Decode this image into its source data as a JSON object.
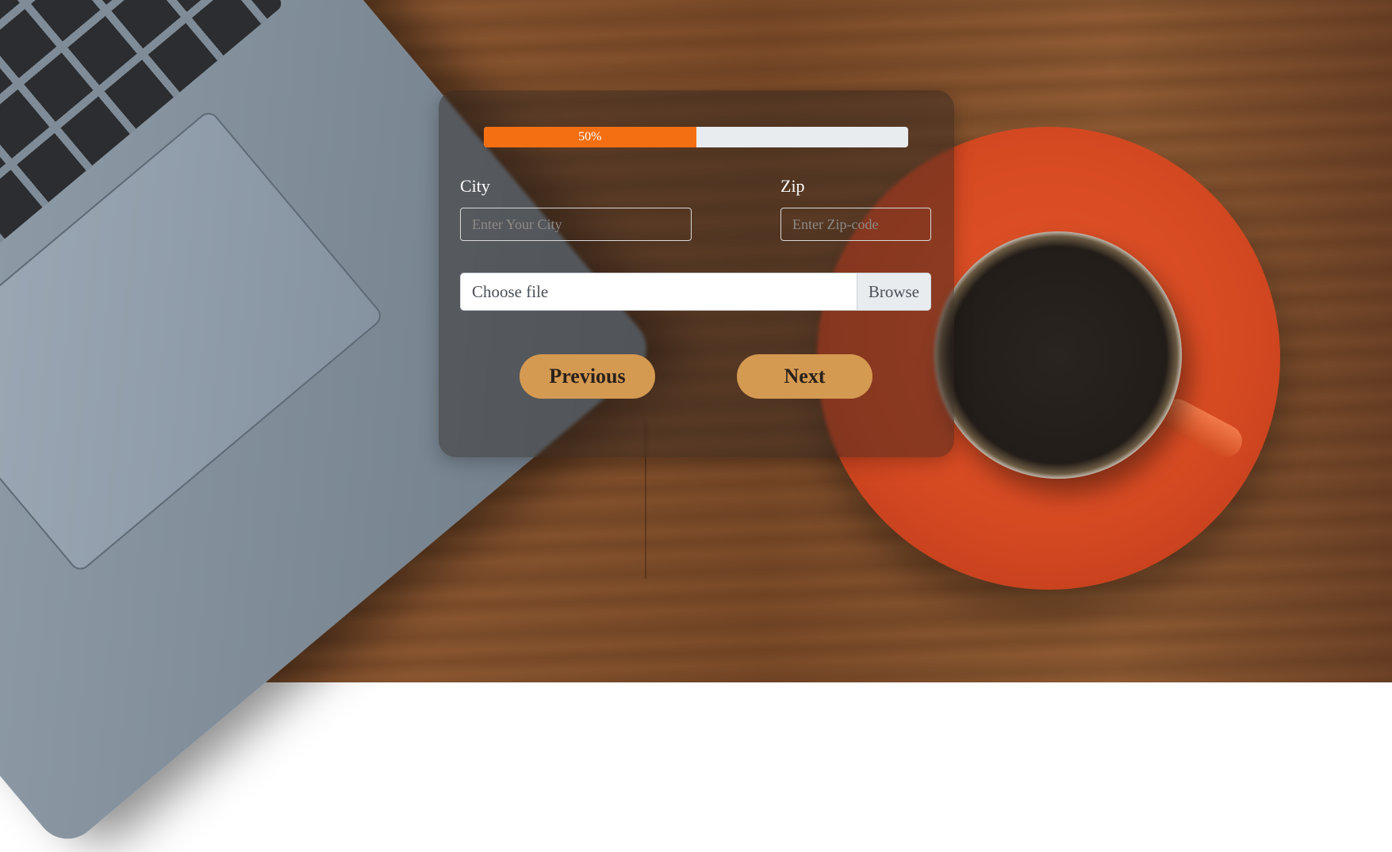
{
  "progress": {
    "value": 50,
    "label": "50%"
  },
  "form": {
    "city": {
      "label": "City",
      "placeholder": "Enter Your City",
      "value": ""
    },
    "zip": {
      "label": "Zip",
      "placeholder": "Enter Zip-code",
      "value": ""
    },
    "file": {
      "text": "Choose file",
      "button": "Browse"
    }
  },
  "buttons": {
    "previous": "Previous",
    "next": "Next"
  },
  "colors": {
    "progress_fill": "#f46f12",
    "button_bg": "#d59a51",
    "card_bg": "rgba(45,35,30,0.45)"
  }
}
